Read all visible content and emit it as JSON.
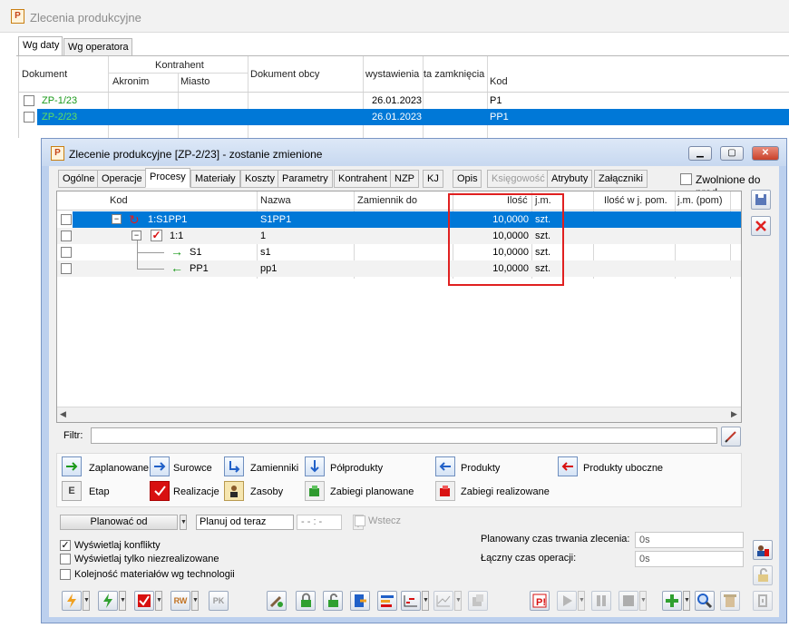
{
  "app": {
    "title": "Zlecenia produkcyjne",
    "icon_letter": "P"
  },
  "main_tabs": [
    {
      "label": "Wg daty"
    },
    {
      "label": "Wg operatora"
    }
  ],
  "main_table": {
    "headers": {
      "dokument": "Dokument",
      "kontrahent": "Kontrahent",
      "akronim": "Akronim",
      "miasto": "Miasto",
      "dokument_obcy": "Dokument obcy",
      "wystawienia": "wystawienia",
      "zamkniecia": "ta zamknięcia",
      "kod": "Kod"
    },
    "rows": [
      {
        "doc": "ZP-1/23",
        "date": "26.01.2023",
        "kod": "P1",
        "selected": false
      },
      {
        "doc": "ZP-2/23",
        "date": "26.01.2023",
        "kod": "PP1",
        "selected": true
      }
    ]
  },
  "dialog": {
    "title": "Zlecenie produkcyjne  [ZP-2/23] - zostanie zmienione",
    "tabs": [
      {
        "label": "Ogólne"
      },
      {
        "label": "Operacje"
      },
      {
        "label": "Procesy"
      },
      {
        "label": "Materiały"
      },
      {
        "label": "Koszty"
      },
      {
        "label": "Parametry"
      },
      {
        "label": "Kontrahent"
      },
      {
        "label": "NZP"
      },
      {
        "label": "KJ"
      },
      {
        "label": "Opis"
      },
      {
        "label": "Księgowość"
      },
      {
        "label": "Atrybuty"
      },
      {
        "label": "Załączniki"
      }
    ],
    "zwolnione_label": "Zwolnione do prod.",
    "grid": {
      "headers": {
        "kod": "Kod",
        "nazwa": "Nazwa",
        "zamiennik": "Zamiennik do",
        "ilosc": "Ilość",
        "jm": "j.m.",
        "ilosc_pom": "Ilość w j. pom.",
        "jm_pom": "j.m. (pom)"
      },
      "rows": [
        {
          "kod": "1:S1PP1",
          "nazwa": "S1PP1",
          "ilosc": "10,0000",
          "jm": "szt.",
          "selected": true
        },
        {
          "kod": "1:1",
          "nazwa": "1",
          "ilosc": "10,0000",
          "jm": "szt.",
          "selected": false
        },
        {
          "kod": "S1",
          "nazwa": "s1",
          "ilosc": "10,0000",
          "jm": "szt.",
          "selected": false
        },
        {
          "kod": "PP1",
          "nazwa": "pp1",
          "ilosc": "10,0000",
          "jm": "szt.",
          "selected": false
        }
      ]
    },
    "filter_label": "Filtr:",
    "legend": [
      {
        "label": "Zaplanowane"
      },
      {
        "label": "Surowce"
      },
      {
        "label": "Zamienniki"
      },
      {
        "label": "Półprodukty"
      },
      {
        "label": "Produkty"
      },
      {
        "label": "Produkty uboczne"
      },
      {
        "label": "Etap"
      },
      {
        "label": "Realizacje"
      },
      {
        "label": "Zasoby"
      },
      {
        "label": "Zabiegi planowane"
      },
      {
        "label": "Zabiegi realizowane"
      }
    ],
    "planowac_od": "Planować od",
    "planuj_od_teraz": "Planuj od teraz",
    "time_placeholder": "- - : -",
    "wstecz": "Wstecz",
    "checks": [
      {
        "label": "Wyświetlaj konflikty",
        "checked": true
      },
      {
        "label": "Wyświetlaj tylko niezrealizowane",
        "checked": false
      },
      {
        "label": "Kolejność materiałów wg technologii",
        "checked": false
      }
    ],
    "planowany_czas_label": "Planowany czas trwania zlecenia:",
    "planowany_czas_value": "0s",
    "laczny_czas_label": "Łączny czas operacji:",
    "laczny_czas_value": "0s",
    "colors": {
      "accent": "#0078d7",
      "highlight_box": "#e02020",
      "green_text": "#1a9a1a"
    }
  }
}
